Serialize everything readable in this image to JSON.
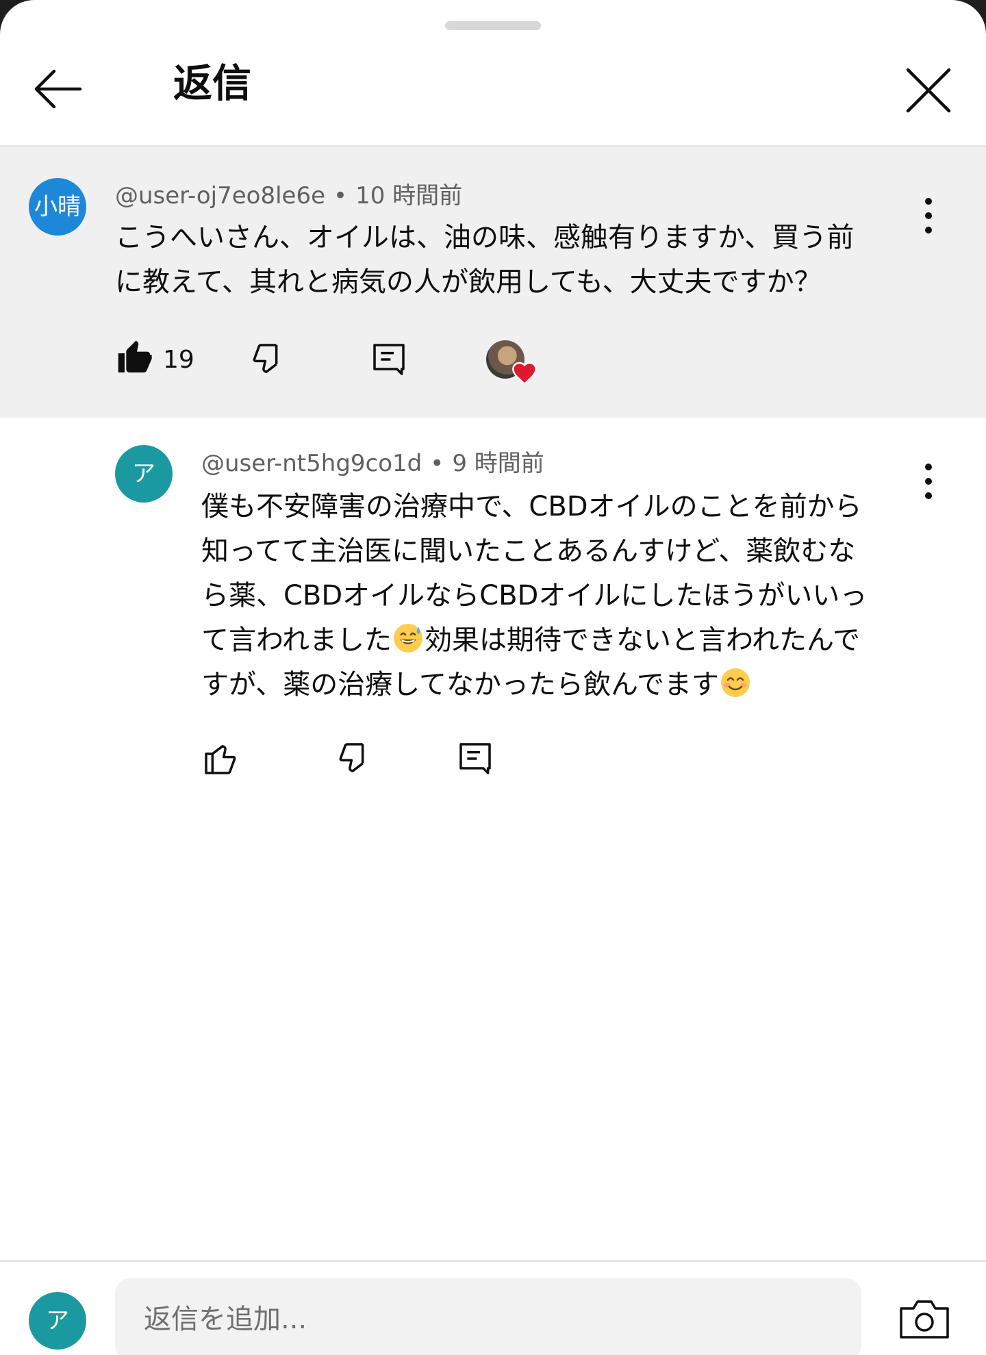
{
  "header": {
    "title": "返信",
    "back_icon": "arrow-back-icon",
    "close_icon": "close-icon"
  },
  "parent_comment": {
    "avatar_text": "小晴",
    "author": "@user-oj7eo8le6e",
    "separator": "•",
    "time": "10 時間前",
    "text_lines": [
      "こうへいさん、オイルは、油の味、感触有りますか、買う前",
      "に教えて、其れと病気の人が飲用しても、大丈夫ですか？"
    ],
    "like_count": "19",
    "liked": true,
    "creator_hearted": true
  },
  "reply": {
    "avatar_text": "ア",
    "author": "@user-nt5hg9co1d",
    "separator": "•",
    "time": "9 時間前",
    "line1": "僕も不安障害の治療中で、CBDオイルのことを前から",
    "line2": "知ってて主治医に聞いたことあるんすけど、薬飲むな",
    "line3": "ら薬、CBDオイルならCBDオイルにしたほうがいいっ",
    "line4_before_emoji": "て言われました",
    "line4_after_emoji": "効果は期待できないと言われたんで",
    "line5_before_emoji": "すが、薬の治療してなかったら飲んでます",
    "emoji_1": "grinning-sweat-emoji",
    "emoji_2": "smiling-blush-emoji"
  },
  "composer": {
    "avatar_text": "ア",
    "placeholder": "返信を追加..."
  },
  "colors": {
    "parent_avatar": "#1e88d8",
    "reply_avatar": "#1a9aa0",
    "highlight_bg": "#f0f0f0",
    "meta_text": "#606060",
    "heart": "#e0182d"
  }
}
